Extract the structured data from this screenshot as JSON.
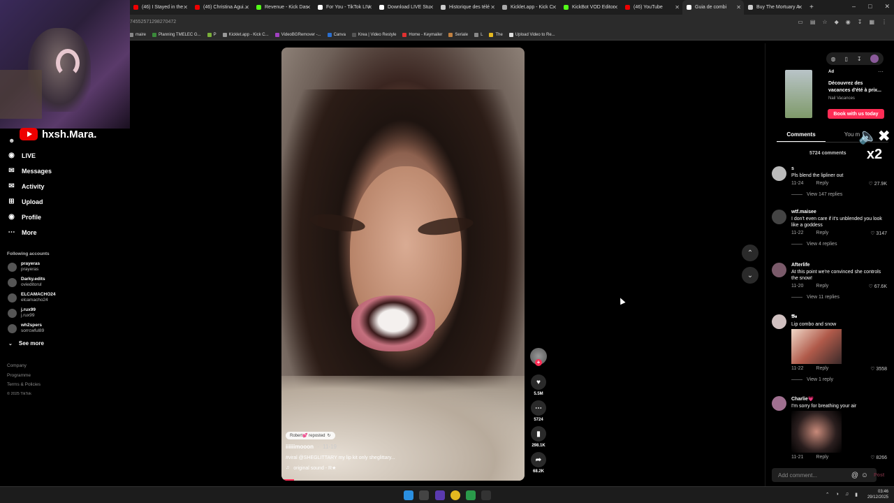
{
  "browser": {
    "tabs": [
      {
        "label": "(46) I Stayed in the",
        "color": "#e00"
      },
      {
        "label": "(46) Christina Agui...",
        "color": "#e00"
      },
      {
        "label": "Revenue - Kick Das",
        "color": "#53fc18"
      },
      {
        "label": "For You - TikTok LIV",
        "color": "#fff"
      },
      {
        "label": "Download LIVE Stu",
        "color": "#fff"
      },
      {
        "label": "Historique des télé",
        "color": "#ccc"
      },
      {
        "label": "Kicklet.app - Kick C",
        "color": "#aaa"
      },
      {
        "label": "KickBot VOD Editor",
        "color": "#53fc18"
      },
      {
        "label": "(46) YouTube",
        "color": "#e00"
      },
      {
        "label": "Guia de combi",
        "color": "#fff"
      },
      {
        "label": "Buy The Mortuary A",
        "color": "#ccc"
      }
    ],
    "url": "74552571298270472",
    "bookmarks": [
      "maire",
      "Planning TMELEC G...",
      "P",
      "Kicklet.app - Kick C...",
      "VideoBGRemover -...",
      "Canva",
      "Krea | Video Restyle",
      "Home - Keymailer",
      "Seriale",
      "L",
      "The",
      "Upload Video to Re..."
    ]
  },
  "stream_overlay": {
    "channel": "hxsh.Mara."
  },
  "sidebar": {
    "nav": [
      {
        "label": "LIVE",
        "icon": "live-icon"
      },
      {
        "label": "Messages",
        "icon": "messages-icon"
      },
      {
        "label": "Activity",
        "icon": "activity-icon"
      },
      {
        "label": "Upload",
        "icon": "upload-icon"
      },
      {
        "label": "Profile",
        "icon": "profile-icon"
      },
      {
        "label": "More",
        "icon": "more-icon"
      }
    ],
    "following_title": "Following accounts",
    "following": [
      {
        "name": "prayeras",
        "handle": "prayeras"
      },
      {
        "name": "Darky.edits",
        "handle": "ovieditorul"
      },
      {
        "name": "ELCAMACHO24",
        "handle": "elcamacho24"
      },
      {
        "name": "j.rux99",
        "handle": "j.rux99"
      },
      {
        "name": "wh2spers",
        "handle": "sorrcwful89"
      }
    ],
    "see_more": "See more",
    "footer": [
      "Company",
      "Programme",
      "Terms & Policies",
      "© 2025 TikTok"
    ]
  },
  "video": {
    "repost_label": "Robert💕 reposted",
    "author": "iiiiiimooon",
    "date": "11-19",
    "caption": "#viral @SHEGLITTARY my lip kit only sheglittary...",
    "sound": "original sound - R★",
    "counts": {
      "likes": "5.5M",
      "comments": "5724",
      "saves": "298.1K",
      "shares": "68.2K"
    }
  },
  "ad": {
    "badge": "Ad",
    "title": "Découvrez des vacances d'été à prix...",
    "brand": "Nail Vacances",
    "cta": "Book with us today"
  },
  "comments_panel": {
    "tabs": [
      "Comments",
      "You m"
    ],
    "count": "5724 comments",
    "reply_label": "Reply",
    "items": [
      {
        "user": "s",
        "text": "Pls blend the lipliner out",
        "date": "11-24",
        "likes": "27.9K",
        "replies": "View 147 replies"
      },
      {
        "user": "wtf.maisee",
        "text": "I don't even care if it's unblended you look like a goddess",
        "date": "11-22",
        "likes": "3147",
        "replies": "View 4 replies"
      },
      {
        "user": "Afterlife",
        "text": "At this point we're convinced she controls the snow!",
        "date": "11-20",
        "likes": "67.6K",
        "replies": "View 11 replies"
      },
      {
        "user": "𝕭𝖘",
        "text": "Lip combo and snow",
        "date": "11-22",
        "likes": "3558",
        "replies": "View 1 reply"
      },
      {
        "user": "Charlie💗",
        "text": "I'm sorry for breathing your air",
        "date": "11-21",
        "likes": "8266",
        "replies": ""
      }
    ],
    "add_placeholder": "Add comment...",
    "post_label": "Post"
  },
  "overlay_badge": "x2",
  "taskbar": {
    "time": "03:46",
    "date": "29/12/2025"
  }
}
